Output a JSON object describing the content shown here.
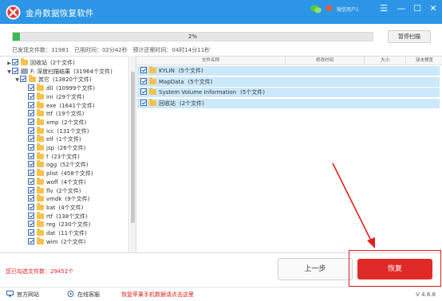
{
  "app": {
    "title": "金舟数据恢复软件",
    "user_label": "微信用户1",
    "minimize": "—",
    "restore": "☐",
    "close": "✕",
    "menu": "☰"
  },
  "scan": {
    "progress_percent": 2,
    "progress_text": "2%",
    "pause_label": "暂停扫描",
    "stats": "已发现文件数：31981   已用时间：02分42秒   预计还需时间：04时14分11秒"
  },
  "tree": [
    {
      "indent": 0,
      "arrow": "▶",
      "icon": "folder",
      "checked": true,
      "label": "回收站",
      "count": "(2个文件)"
    },
    {
      "indent": 0,
      "arrow": "▼",
      "icon": "drive",
      "checked": true,
      "label": "F: 深度扫描结果",
      "count": "(31964个文件)"
    },
    {
      "indent": 1,
      "arrow": "▼",
      "icon": "folder",
      "checked": true,
      "label": "其它",
      "count": "(13820个文件)"
    },
    {
      "indent": 2,
      "arrow": "",
      "icon": "folder",
      "checked": true,
      "label": "dll",
      "count": "(10999个文件)"
    },
    {
      "indent": 2,
      "arrow": "",
      "icon": "folder",
      "checked": true,
      "label": "ini",
      "count": "(29个文件)"
    },
    {
      "indent": 2,
      "arrow": "",
      "icon": "folder",
      "checked": true,
      "label": "exe",
      "count": "(1641个文件)"
    },
    {
      "indent": 2,
      "arrow": "",
      "icon": "folder",
      "checked": true,
      "label": "ttf",
      "count": "(19个文件)"
    },
    {
      "indent": 2,
      "arrow": "",
      "icon": "folder",
      "checked": true,
      "label": "xmp",
      "count": "(2个文件)"
    },
    {
      "indent": 2,
      "arrow": "",
      "icon": "folder",
      "checked": true,
      "label": "icc",
      "count": "(131个文件)"
    },
    {
      "indent": 2,
      "arrow": "",
      "icon": "folder",
      "checked": true,
      "label": "elf",
      "count": "(1个文件)"
    },
    {
      "indent": 2,
      "arrow": "",
      "icon": "folder",
      "checked": true,
      "label": "jsp",
      "count": "(26个文件)"
    },
    {
      "indent": 2,
      "arrow": "",
      "icon": "folder",
      "checked": true,
      "label": "f",
      "count": "(23个文件)"
    },
    {
      "indent": 2,
      "arrow": "",
      "icon": "folder",
      "checked": true,
      "label": "ogg",
      "count": "(52个文件)"
    },
    {
      "indent": 2,
      "arrow": "",
      "icon": "folder",
      "checked": true,
      "label": "plist",
      "count": "(458个文件)"
    },
    {
      "indent": 2,
      "arrow": "",
      "icon": "folder",
      "checked": true,
      "label": "woff",
      "count": "(4个文件)"
    },
    {
      "indent": 2,
      "arrow": "",
      "icon": "folder",
      "checked": true,
      "label": "flv",
      "count": "(2个文件)"
    },
    {
      "indent": 2,
      "arrow": "",
      "icon": "folder",
      "checked": true,
      "label": "vmdk",
      "count": "(9个文件)"
    },
    {
      "indent": 2,
      "arrow": "",
      "icon": "folder",
      "checked": true,
      "label": "bat",
      "count": "(4个文件)"
    },
    {
      "indent": 2,
      "arrow": "",
      "icon": "folder",
      "checked": true,
      "label": "rtf",
      "count": "(138个文件)"
    },
    {
      "indent": 2,
      "arrow": "",
      "icon": "folder",
      "checked": true,
      "label": "reg",
      "count": "(230个文件)"
    },
    {
      "indent": 2,
      "arrow": "",
      "icon": "folder",
      "checked": true,
      "label": "dat",
      "count": "(11个文件)"
    },
    {
      "indent": 2,
      "arrow": "",
      "icon": "folder",
      "checked": true,
      "label": "wim",
      "count": "(2个文件)"
    }
  ],
  "columns": [
    "文件名称",
    "修改时间",
    "大小",
    "双击预览"
  ],
  "files": [
    {
      "name": "KYLIN",
      "count": "(5个文件)"
    },
    {
      "name": "MapData",
      "count": "(5个文件)"
    },
    {
      "name": "System Volume Information",
      "count": "(5个文件)"
    },
    {
      "name": "回收站",
      "count": "(2个文件)"
    }
  ],
  "bottom": {
    "selected_count": "您已勾选文件数：29452个",
    "prev_label": "上一步",
    "recover_label": "恢复"
  },
  "footer": {
    "website": "官方网站",
    "support": "在线客服",
    "phone_recovery": "恢复苹果手机数据请点击这里",
    "version": "V 4.6.8"
  },
  "colors": {
    "titlebar": "#2c95e6",
    "accent_red": "#e02a27",
    "selection": "#cce8fb",
    "progress": "#3cba54"
  }
}
